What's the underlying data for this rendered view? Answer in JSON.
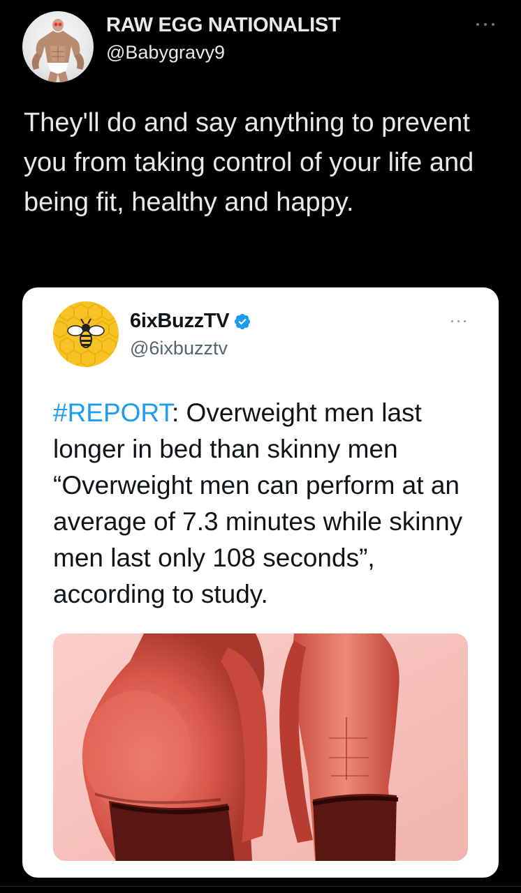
{
  "outer_tweet": {
    "display_name": "RAW EGG NATIONALIST",
    "handle": "@Babygravy9",
    "text": "They'll do and say anything to prevent you from taking control of your life and being fit, healthy and happy.",
    "avatar_icon": "bodybuilder-avatar"
  },
  "quoted_tweet": {
    "display_name": "6ixBuzzTV",
    "handle": "@6ixbuzztv",
    "verified": true,
    "avatar_icon": "bee-logo",
    "hashtag": "#REPORT",
    "text_after_hashtag": ": Overweight men last longer in bed than skinny men “Overweight men can perform at an average of 7.3 minutes while skinny men last only 108 seconds”, according to study.",
    "media_description_icon": "overweight-vs-skinny-torsos-image"
  },
  "colors": {
    "background": "#000000",
    "text_primary": "#e7e9ea",
    "card_background": "#ffffff",
    "hashtag_link": "#1d9bf0",
    "verified_badge": "#1d9bf0",
    "handle_gray": "#536471",
    "media_tint": "#e8746a"
  }
}
